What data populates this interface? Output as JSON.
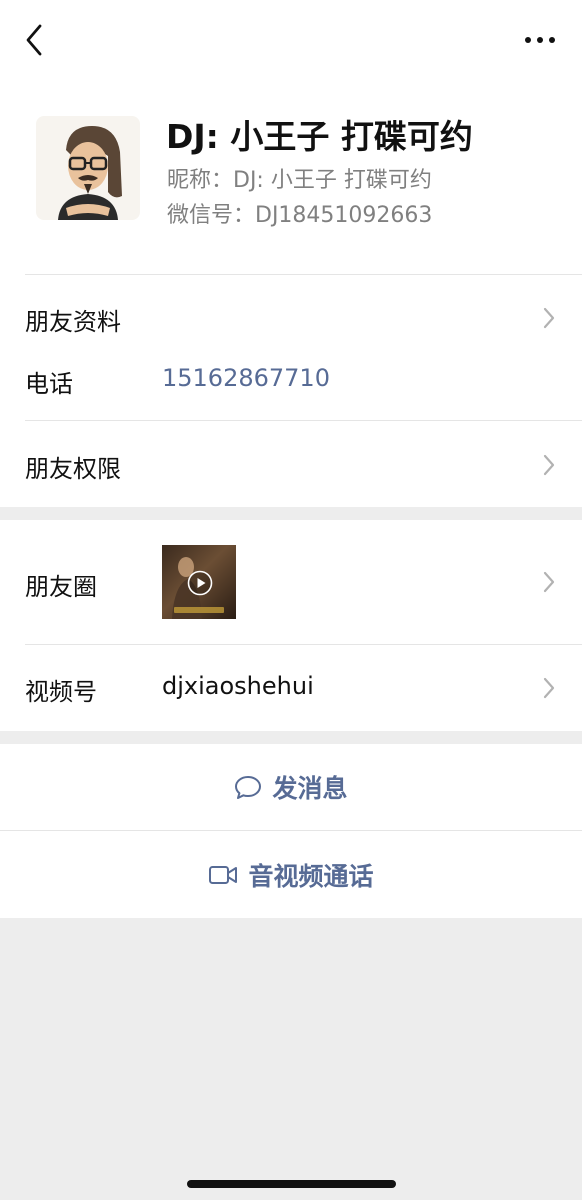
{
  "header": {
    "back_icon": "chevron-left-icon",
    "more_icon": "ellipsis-icon"
  },
  "profile": {
    "display_name": "DJ: 小王子 打碟可约",
    "nickname": "昵称：DJ: 小王子 打碟可约",
    "wechat_id": "微信号：DJ18451092663"
  },
  "info": {
    "friend_profile_label": "朋友资料",
    "phone_label": "电话",
    "phone_value": "15162867710",
    "friend_permissions_label": "朋友权限"
  },
  "social": {
    "moments_label": "朋友圈",
    "channels_label": "视频号",
    "channels_value": "djxiaoshehui"
  },
  "actions": {
    "send_message_label": "发消息",
    "video_call_label": "音视频通话"
  },
  "colors": {
    "link_blue": "#576b95",
    "background": "#ededed",
    "secondary_text": "#808080"
  }
}
